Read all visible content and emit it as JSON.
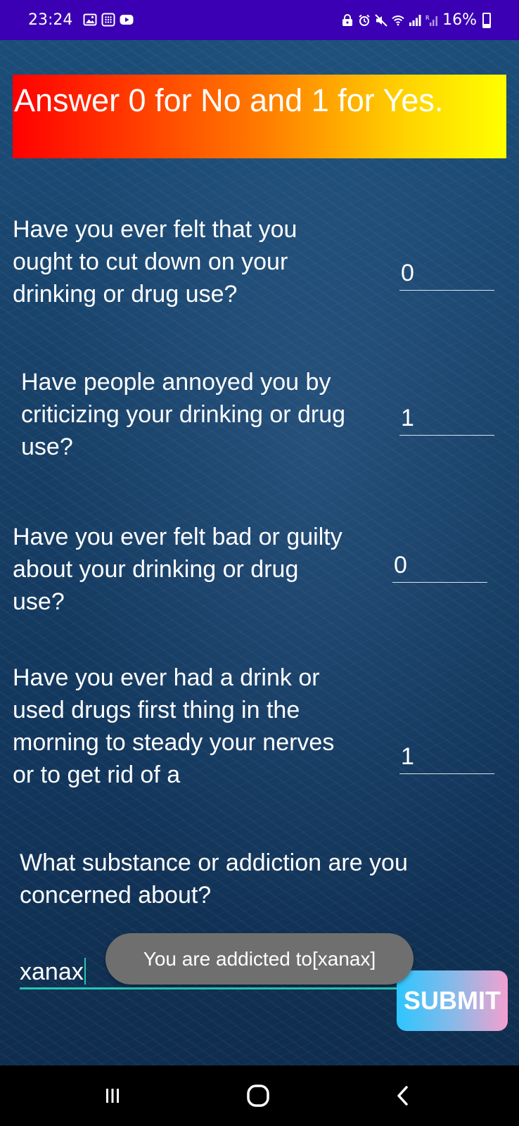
{
  "status_bar": {
    "time": "23:24",
    "battery": "16%",
    "left_icons": [
      "gallery-icon",
      "keypad-icon",
      "youtube-icon"
    ],
    "right_icons": [
      "lock-icon",
      "alarm-icon",
      "mute-icon",
      "wifi-icon",
      "signal-icon",
      "roaming-signal-icon",
      "battery-icon"
    ]
  },
  "banner": {
    "text": "Answer 0 for No and 1 for Yes."
  },
  "questions": [
    {
      "text": "Have you ever felt that you ought to cut down on your drinking or drug use?",
      "answer": "0"
    },
    {
      "text": "Have people annoyed you by criticizing your drinking or drug use?",
      "answer": "1"
    },
    {
      "text": "Have you ever felt bad or guilty about your drinking or drug use?",
      "answer": "0"
    },
    {
      "text": "Have you ever had a drink or used drugs first thing in the morning to steady your nerves or to get rid of a",
      "answer": "1"
    }
  ],
  "concern": {
    "label": "What substance or addiction are you concerned about?",
    "value": "xanax"
  },
  "submit_label": "SUBMIT",
  "toast": "You are addicted to[xanax]",
  "nav_bar": {
    "icons": [
      "recent-apps-icon",
      "home-icon",
      "back-icon"
    ]
  },
  "colors": {
    "status_bar": "#3b00b3",
    "input_underline": "#26c6b3",
    "banner_gradient": [
      "#ff0000",
      "#ff7a00",
      "#ffff00"
    ],
    "submit_gradient": [
      "#2cc6ff",
      "#f3a0cf"
    ]
  }
}
